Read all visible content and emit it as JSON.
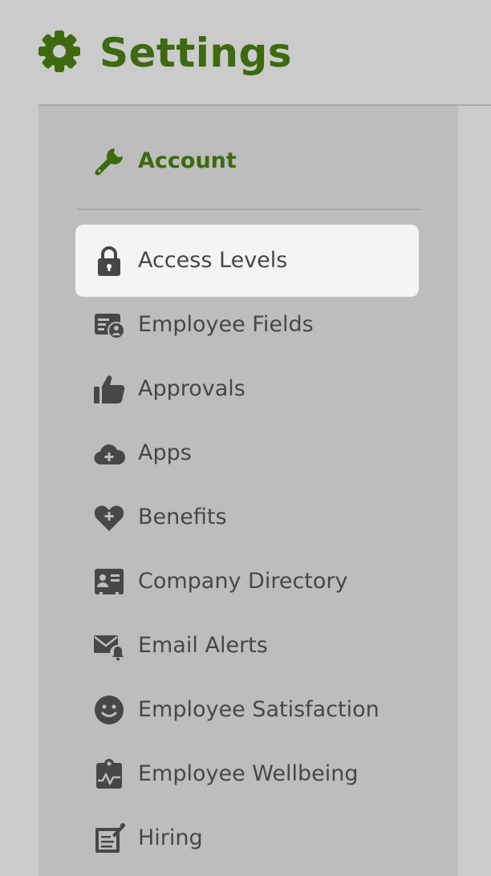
{
  "header": {
    "title": "Settings",
    "icon": "gear-icon",
    "accent_color": "#3d6a0f"
  },
  "sidebar": {
    "selected": "Access Levels",
    "items": [
      {
        "label": "Account",
        "icon": "wrench-icon"
      },
      {
        "label": "Access Levels",
        "icon": "lock-icon"
      },
      {
        "label": "Employee Fields",
        "icon": "employee-fields-icon"
      },
      {
        "label": "Approvals",
        "icon": "thumbs-up-icon"
      },
      {
        "label": "Apps",
        "icon": "cloud-plus-icon"
      },
      {
        "label": "Benefits",
        "icon": "heart-plus-icon"
      },
      {
        "label": "Company Directory",
        "icon": "id-card-icon"
      },
      {
        "label": "Email Alerts",
        "icon": "mail-bell-icon"
      },
      {
        "label": "Employee Satisfaction",
        "icon": "smiley-icon"
      },
      {
        "label": "Employee Wellbeing",
        "icon": "clipboard-heartbeat-icon"
      },
      {
        "label": "Hiring",
        "icon": "document-pin-icon"
      }
    ]
  }
}
